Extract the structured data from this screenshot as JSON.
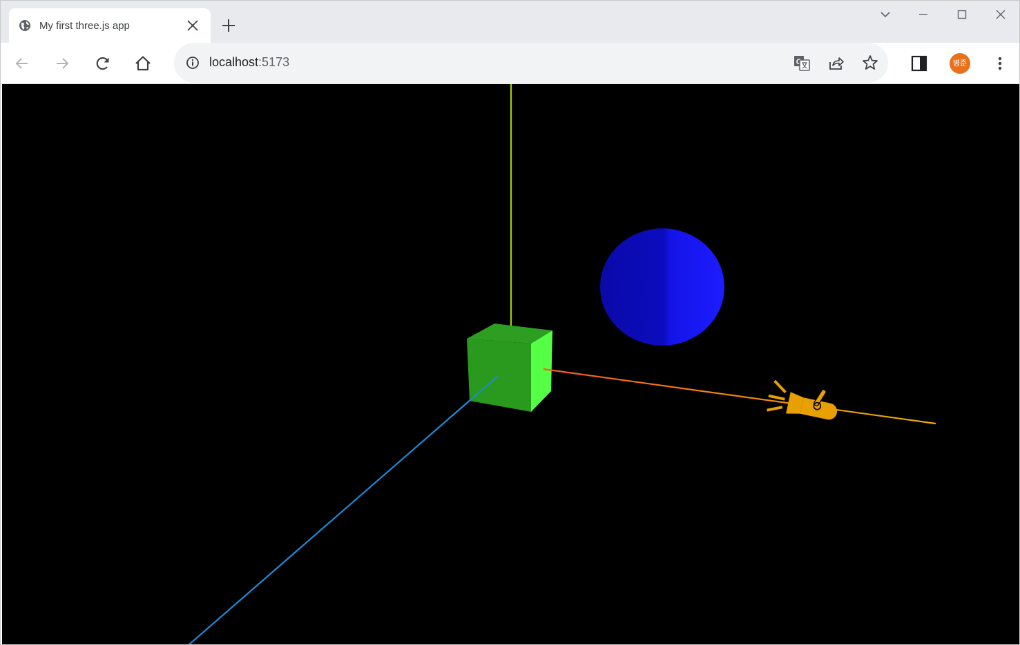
{
  "tab": {
    "title": "My first three.js app",
    "favicon": "globe-icon"
  },
  "address_bar": {
    "host": "localhost",
    "port": ":5173",
    "info_icon": "info-icon"
  },
  "profile": {
    "avatar_text": "병준",
    "avatar_color": "#e8711c"
  },
  "scene": {
    "background": "#000000",
    "axes_colors": {
      "x": "#ff6a00",
      "y": "#9bd400",
      "z": "#1f8ad8"
    },
    "cube_color": "#2a9a1e",
    "sphere_color": "#1a1aff",
    "light_helper_color": "#e8a000",
    "light_helper_icon": "spotlight-icon"
  }
}
